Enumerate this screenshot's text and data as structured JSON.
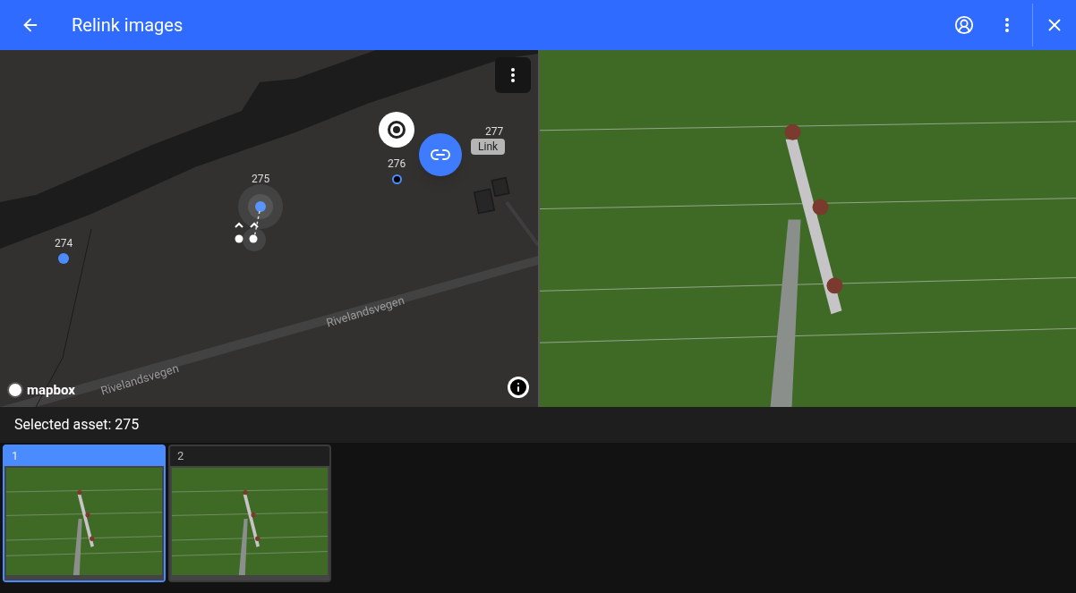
{
  "app_bar": {
    "title": "Relink images"
  },
  "map": {
    "assets": [
      {
        "label": "274",
        "kind": "dot"
      },
      {
        "label": "275",
        "kind": "selected"
      },
      {
        "label": "276",
        "kind": "ring"
      },
      {
        "label": "277",
        "kind": "hidden"
      }
    ],
    "link_tooltip": "Link",
    "roads": [
      "Rivelandsvegen",
      "Rivelandsvegen"
    ],
    "attribution": "mapbox"
  },
  "status": {
    "text": "Selected asset: 275"
  },
  "thumbnails": [
    {
      "label": "1",
      "selected": true
    },
    {
      "label": "2",
      "selected": false
    }
  ]
}
